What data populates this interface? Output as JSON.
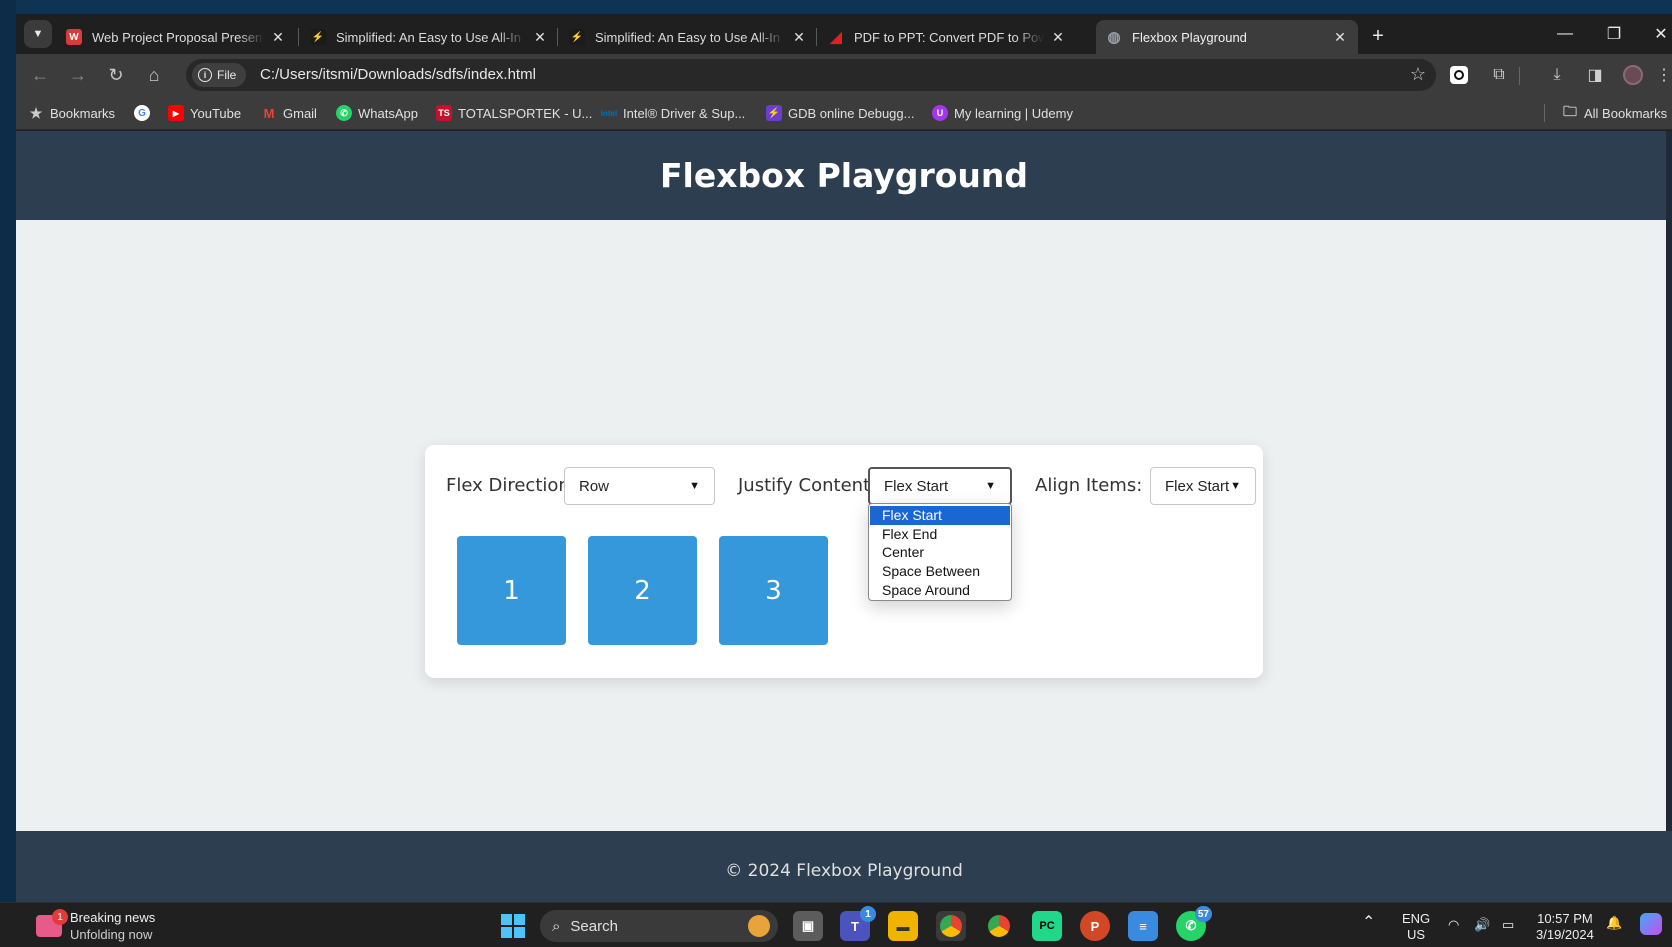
{
  "browser": {
    "tabs": [
      {
        "title": "Web Project Proposal Presentat",
        "favicon_color": "#d93a3a"
      },
      {
        "title": "Simplified: An Easy to Use All-In",
        "favicon_color": "#f0b400"
      },
      {
        "title": "Simplified: An Easy to Use All-In",
        "favicon_color": "#f0b400"
      },
      {
        "title": "PDF to PPT: Convert PDF to Pow",
        "favicon_color": "#e02020"
      },
      {
        "title": "Flexbox Playground",
        "favicon_color": "#9aa0a6"
      }
    ],
    "active_tab_index": 4,
    "file_chip": "File",
    "url": "C:/Users/itsmi/Downloads/sdfs/index.html",
    "bookmarks": [
      {
        "label": "Bookmarks",
        "icon": "star-icon"
      },
      {
        "label": "",
        "icon": "google-icon"
      },
      {
        "label": "YouTube",
        "icon": "youtube-icon"
      },
      {
        "label": "Gmail",
        "icon": "gmail-icon"
      },
      {
        "label": "WhatsApp",
        "icon": "whatsapp-icon"
      },
      {
        "label": "TOTALSPORTEK - U...",
        "icon": "ts-icon"
      },
      {
        "label": "Intel® Driver & Sup...",
        "icon": "intel-icon"
      },
      {
        "label": "GDB online Debugg...",
        "icon": "gdb-icon"
      },
      {
        "label": "My learning | Udemy",
        "icon": "udemy-icon"
      }
    ],
    "all_bookmarks": "All Bookmarks"
  },
  "page": {
    "title": "Flexbox Playground",
    "controls": {
      "flex_direction_label": "Flex Direction:",
      "flex_direction_value": "Row",
      "justify_content_label": "Justify Content:",
      "justify_content_value": "Flex Start",
      "align_items_label": "Align Items:",
      "align_items_value": "Flex Start"
    },
    "justify_options": [
      "Flex Start",
      "Flex End",
      "Center",
      "Space Between",
      "Space Around"
    ],
    "justify_selected_index": 0,
    "boxes": [
      "1",
      "2",
      "3"
    ],
    "footer": "© 2024 Flexbox Playground"
  },
  "taskbar": {
    "news_title": "Breaking news",
    "news_sub": "Unfolding now",
    "news_badge": "1",
    "search_label": "Search",
    "teams_badge": "1",
    "whatsapp_badge": "57",
    "lang_top": "ENG",
    "lang_bottom": "US",
    "time": "10:57 PM",
    "date": "3/19/2024"
  },
  "colors": {
    "header_bg": "#2c3e50",
    "box_bg": "#3498db",
    "page_bg": "#ecf0f1",
    "option_highlight": "#1a66d2"
  }
}
